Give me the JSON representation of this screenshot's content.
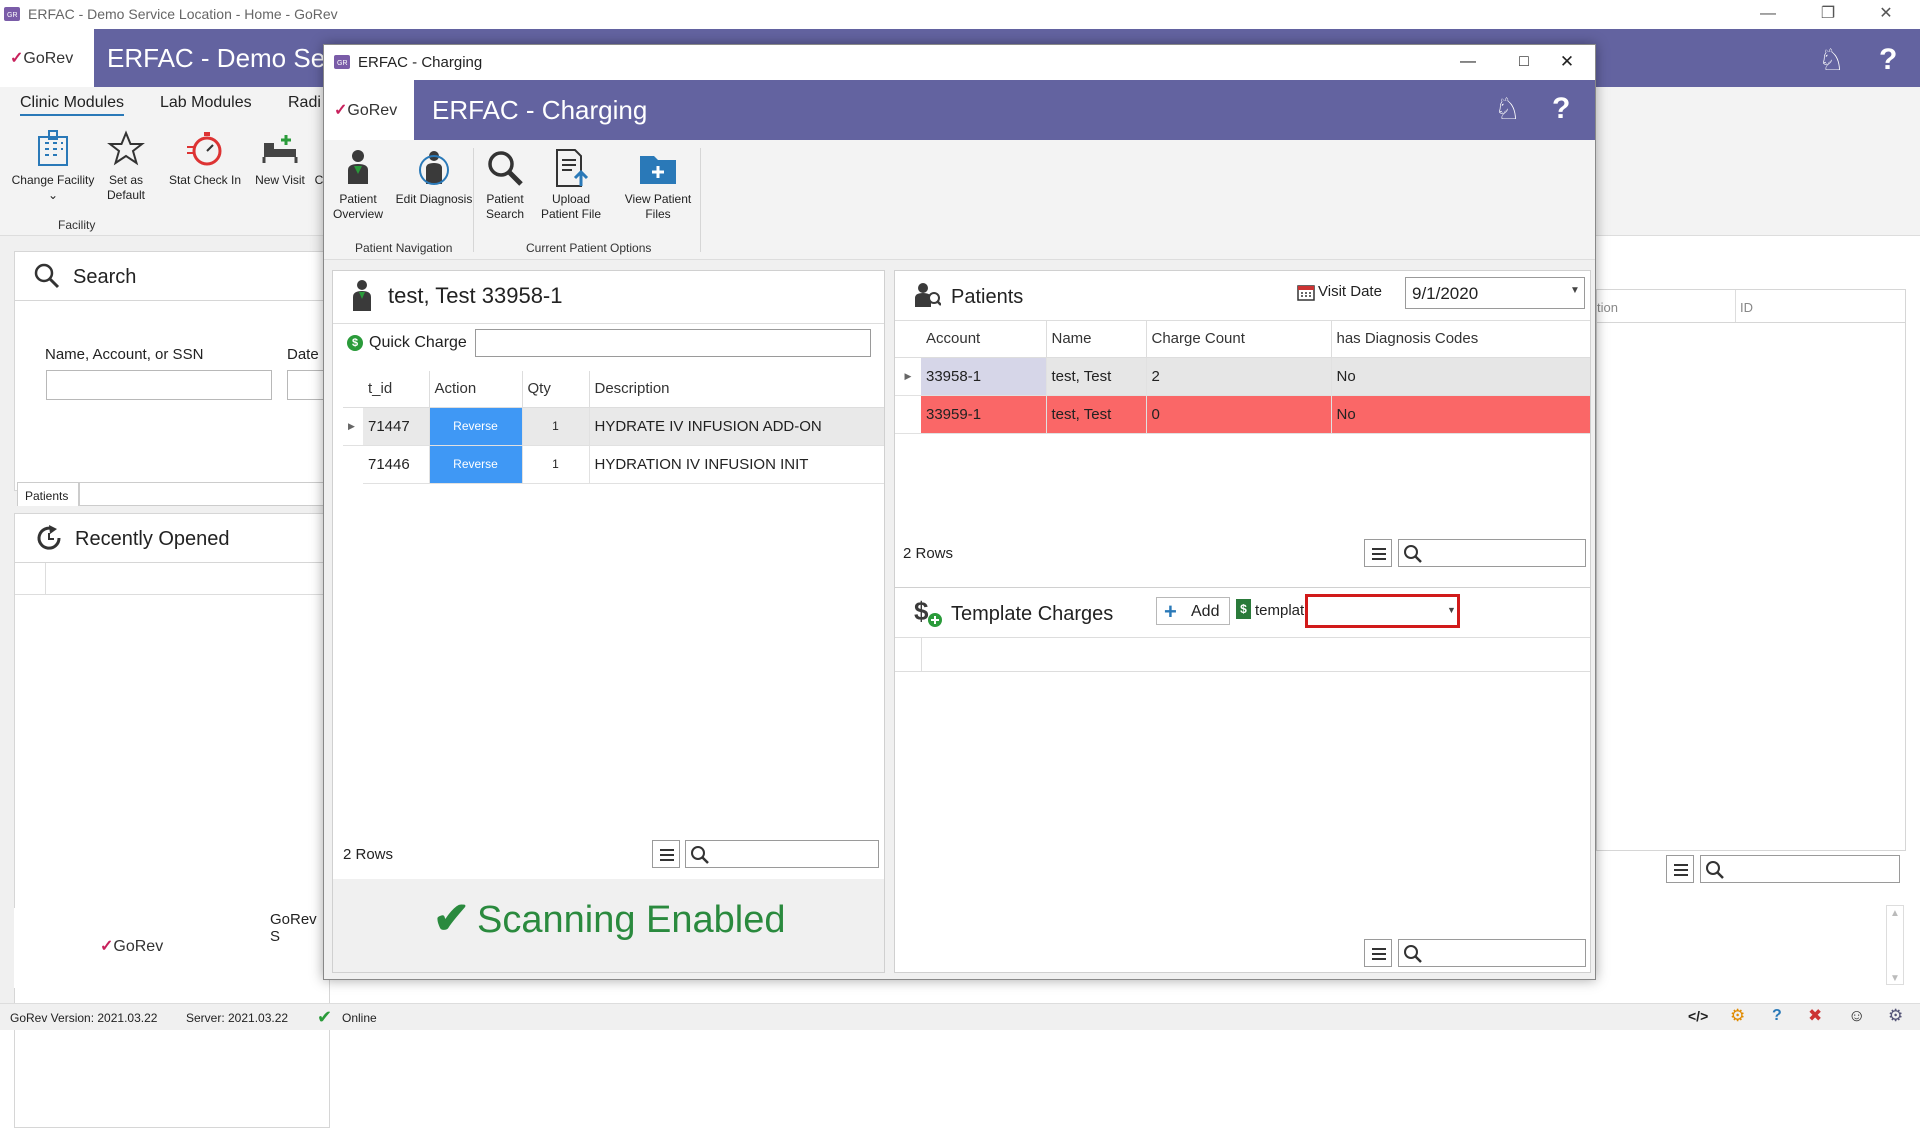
{
  "main_window": {
    "title": "ERFAC - Demo Service Location - Home - GoRev",
    "logo_text": "GoRev",
    "app_title": "ERFAC - Demo Serv",
    "ribbon_tabs": [
      "Clinic Modules",
      "Lab Modules",
      "Radi"
    ],
    "ribbon_buttons": {
      "change_facility": "Change Facility",
      "set_default": "Set as Default",
      "stat_checkin": "Stat Check In",
      "new_visit": "New Visit",
      "cut": "C"
    },
    "group_facility": "Facility",
    "search_title": "Search",
    "name_label": "Name, Account, or SSN",
    "date_label": "Date",
    "patients_tab": "Patients",
    "recent_title": "Recently Opened",
    "footer_logo": "GoRev",
    "footer_text": "GoRev S",
    "right_col_1": "tion",
    "right_col_2": "ID"
  },
  "dialog": {
    "title": "ERFAC - Charging",
    "logo_text": "GoRev",
    "app_title": "ERFAC - Charging",
    "ribbon": {
      "patient_overview": "Patient Overview",
      "edit_diagnosis": "Edit Diagnosis",
      "patient_search": "Patient Search",
      "upload_file": "Upload Patient File",
      "view_files": "View Patient Files",
      "group_nav": "Patient Navigation",
      "group_current": "Current Patient Options"
    },
    "patient_header": "test, Test 33958-1",
    "quick_charge_label": "Quick Charge",
    "charges_table": {
      "columns": [
        "t_id",
        "Action",
        "Qty",
        "Description"
      ],
      "rows": [
        {
          "t_id": "71447",
          "action": "Reverse",
          "qty": "1",
          "description": "HYDRATE IV INFUSION ADD-ON"
        },
        {
          "t_id": "71446",
          "action": "Reverse",
          "qty": "1",
          "description": "HYDRATION IV INFUSION INIT"
        }
      ],
      "row_count": "2 Rows"
    },
    "scanning_text": "Scanning Enabled",
    "patients_panel": {
      "title": "Patients",
      "visit_date_label": "Visit Date",
      "visit_date_value": "9/1/2020",
      "columns": [
        "Account",
        "Name",
        "Charge Count",
        "has Diagnosis Codes"
      ],
      "rows": [
        {
          "account": "33958-1",
          "name": "test, Test",
          "count": "2",
          "diag": "No"
        },
        {
          "account": "33959-1",
          "name": "test, Test",
          "count": "0",
          "diag": "No"
        }
      ],
      "row_count": "2 Rows"
    },
    "template_panel": {
      "title": "Template Charges",
      "add_label": "Add",
      "templates_label": "templates"
    }
  },
  "status_bar": {
    "version": "GoRev Version: 2021.03.22",
    "server": "Server: 2021.03.22",
    "online": "Online"
  }
}
